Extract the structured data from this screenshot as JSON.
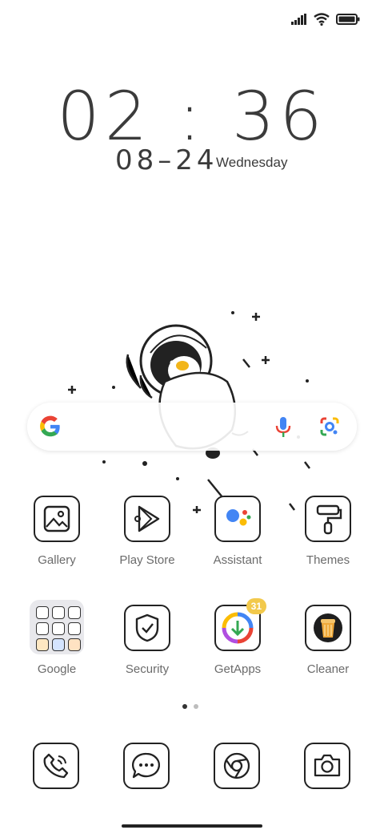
{
  "clock": {
    "time": "02 : 36",
    "date": "08–24",
    "weekday": "Wednesday"
  },
  "status": {
    "icons": [
      "signal-icon",
      "wifi-icon",
      "battery-icon"
    ]
  },
  "search": {
    "icons": [
      "google-icon",
      "mic-icon",
      "lens-icon"
    ]
  },
  "apps": [
    {
      "label": "Gallery",
      "icon": "gallery-icon"
    },
    {
      "label": "Play Store",
      "icon": "play-store-icon"
    },
    {
      "label": "Assistant",
      "icon": "assistant-icon"
    },
    {
      "label": "Themes",
      "icon": "themes-icon"
    },
    {
      "label": "Google",
      "icon": "folder-icon"
    },
    {
      "label": "Security",
      "icon": "security-icon"
    },
    {
      "label": "GetApps",
      "icon": "getapps-icon",
      "badge": "31"
    },
    {
      "label": "Cleaner",
      "icon": "cleaner-icon"
    }
  ],
  "dock": [
    {
      "icon": "phone-icon"
    },
    {
      "icon": "messages-icon"
    },
    {
      "icon": "browser-icon"
    },
    {
      "icon": "camera-icon"
    }
  ],
  "colors": {
    "badge": "#f2c94c",
    "assistant_blue": "#4285F4",
    "assistant_red": "#EA4335",
    "assistant_yellow": "#FBBC05",
    "assistant_green": "#34A853"
  }
}
